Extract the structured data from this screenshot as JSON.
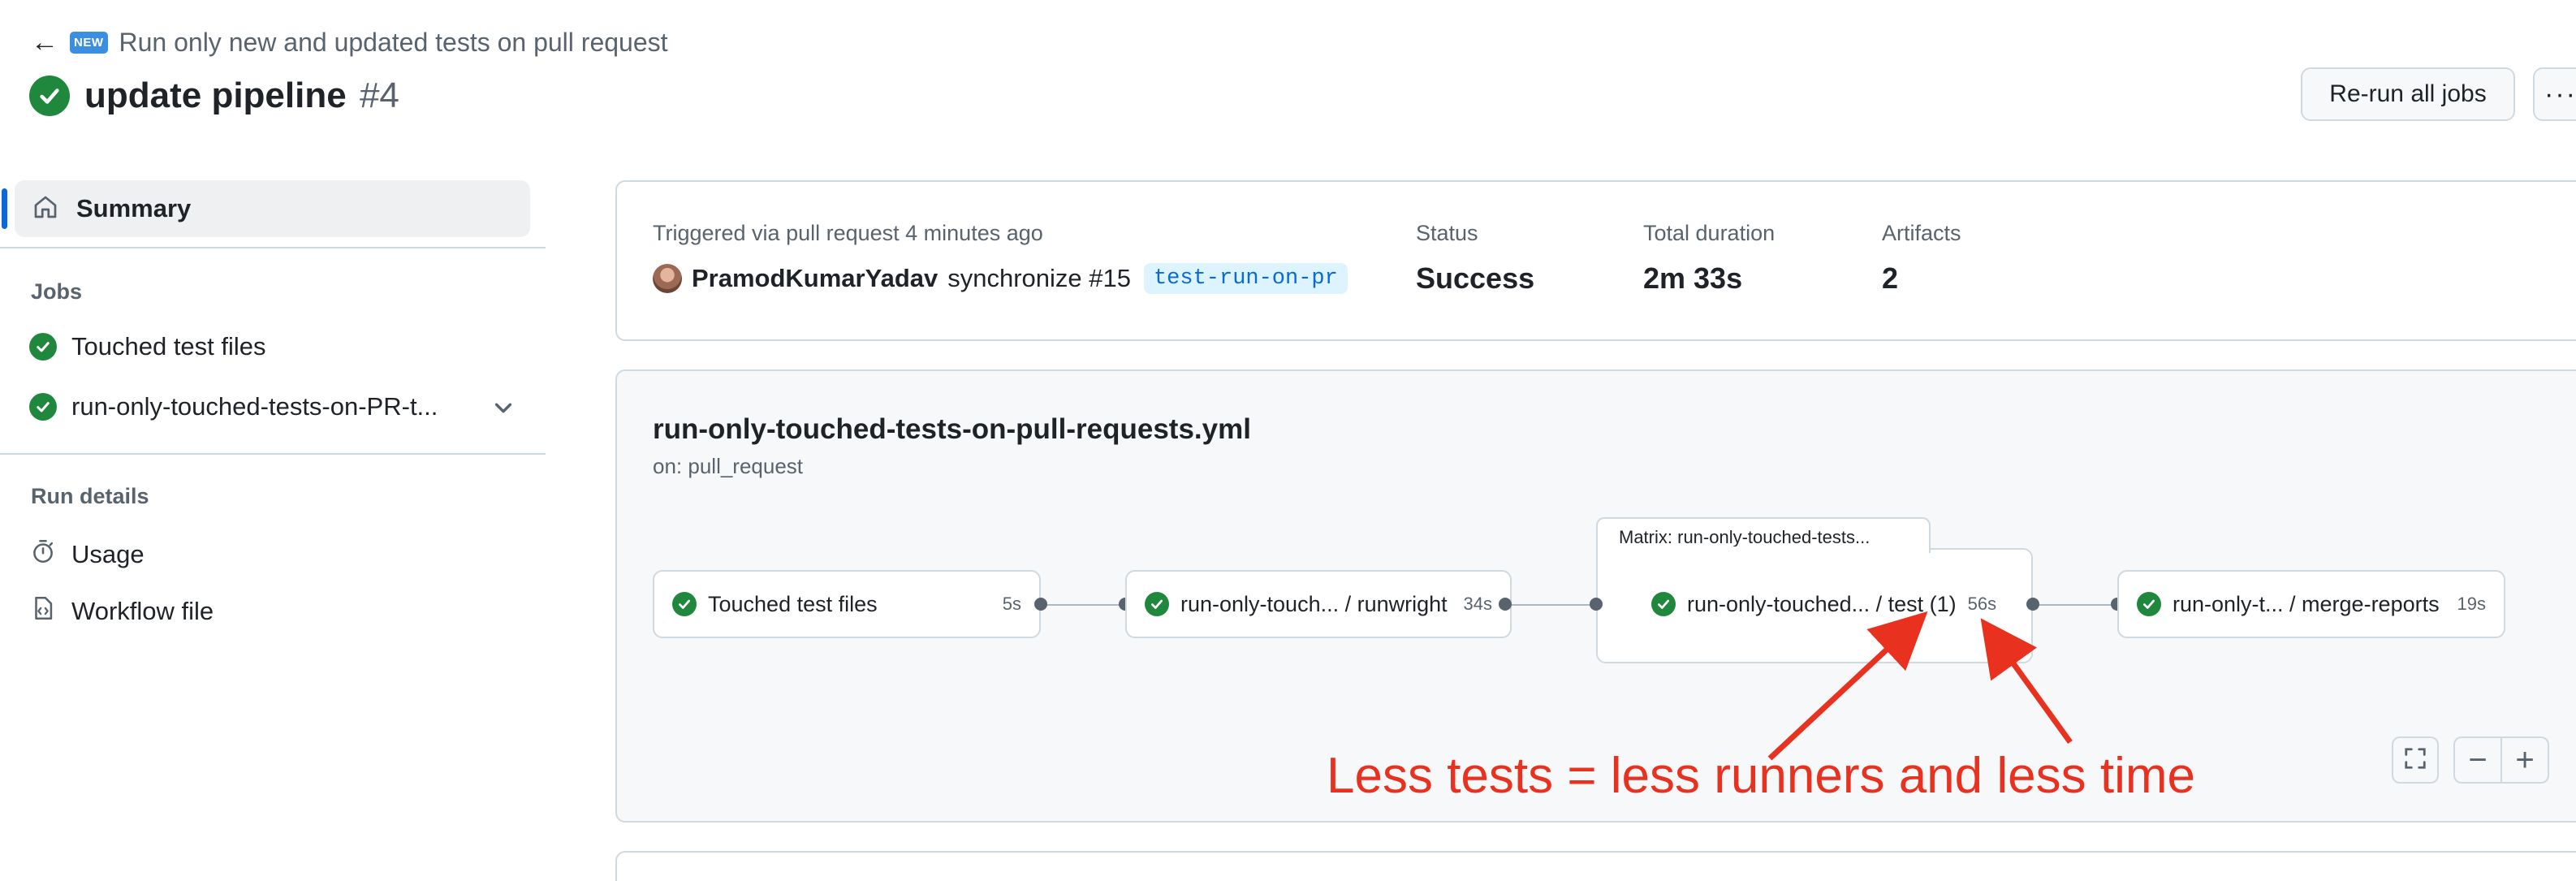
{
  "header": {
    "back_label": "Run only new and updated tests on pull request",
    "new_badge": "NEW",
    "run_title": "update pipeline",
    "run_number": "#4",
    "rerun_label": "Re-run all jobs",
    "more_label": "···"
  },
  "sidebar": {
    "summary_label": "Summary",
    "jobs_heading": "Jobs",
    "jobs": [
      {
        "label": "Touched test files"
      },
      {
        "label": "run-only-touched-tests-on-PR-t..."
      }
    ],
    "run_details_heading": "Run details",
    "details": [
      {
        "label": "Usage",
        "icon": "stopwatch-icon"
      },
      {
        "label": "Workflow file",
        "icon": "file-code-icon"
      }
    ]
  },
  "summary": {
    "trigger_text": "Triggered via pull request 4 minutes ago",
    "actor": "PramodKumarYadav",
    "event_text": "synchronize #15",
    "branch": "test-run-on-pr",
    "status_label": "Status",
    "status_value": "Success",
    "duration_label": "Total duration",
    "duration_value": "2m 33s",
    "artifacts_label": "Artifacts",
    "artifacts_value": "2"
  },
  "workflow": {
    "file_name": "run-only-touched-tests-on-pull-requests.yml",
    "trigger": "on: pull_request",
    "matrix_label": "Matrix: run-only-touched-tests...",
    "jobs": [
      {
        "name": "Touched test files",
        "duration": "5s"
      },
      {
        "name": "run-only-touch... / runwright",
        "duration": "34s"
      },
      {
        "name": "run-only-touched... / test (1)",
        "duration": "56s"
      },
      {
        "name": "run-only-t... / merge-reports",
        "duration": "19s"
      }
    ],
    "zoom_out_label": "−",
    "zoom_in_label": "+"
  },
  "annotation": {
    "text": "Less tests = less runners and less time",
    "color": "#e8321f"
  },
  "colors": {
    "success": "#1f883d",
    "accent": "#0969da"
  }
}
